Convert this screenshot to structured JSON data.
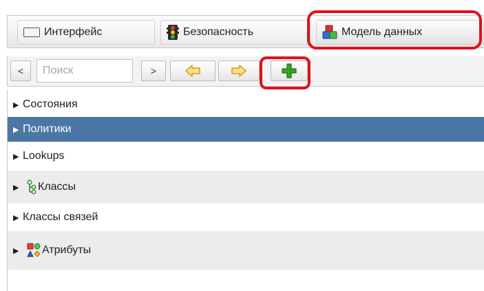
{
  "tabs": [
    {
      "label": "Интерфейс",
      "icon": "window-icon"
    },
    {
      "label": "Безопасность",
      "icon": "traffic-light-icon"
    },
    {
      "label": "Модель данных",
      "icon": "data-model-icon",
      "highlighted": true
    }
  ],
  "toolbar": {
    "prev_label": "<",
    "search_placeholder": "Поиск",
    "next_label": ">",
    "back_icon": "arrow-left-icon",
    "forward_icon": "arrow-right-icon",
    "add_icon": "plus-icon",
    "add_highlighted": true
  },
  "tree": {
    "items": [
      {
        "label": "Состояния"
      },
      {
        "label": "Политики",
        "selected": true
      },
      {
        "label": "Lookups"
      },
      {
        "label": "Классы",
        "icon": "class-hierarchy-icon"
      },
      {
        "label": "Классы связей"
      },
      {
        "label": "Атрибуты",
        "icon": "attributes-icon"
      }
    ]
  },
  "colors": {
    "selection": "#4a77a6",
    "highlight": "#e0111b",
    "add_green": "#2e9b1f",
    "arrow_yellow": "#f2c12e"
  }
}
